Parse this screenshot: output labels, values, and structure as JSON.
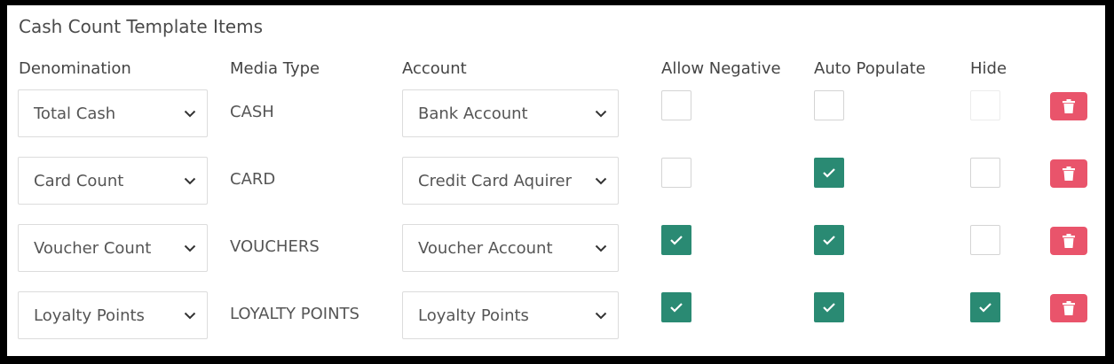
{
  "title": "Cash Count Template Items",
  "columns": {
    "denomination": "Denomination",
    "media_type": "Media Type",
    "account": "Account",
    "allow_negative": "Allow Negative",
    "auto_populate": "Auto Populate",
    "hide": "Hide"
  },
  "rows": [
    {
      "denomination": "Total Cash",
      "media_type": "CASH",
      "account": "Bank Account",
      "allow_negative": false,
      "auto_populate": false,
      "hide": false
    },
    {
      "denomination": "Card Count",
      "media_type": "CARD",
      "account": "Credit Card Aquirer",
      "allow_negative": false,
      "auto_populate": true,
      "hide": false
    },
    {
      "denomination": "Voucher Count",
      "media_type": "VOUCHERS",
      "account": "Voucher Account",
      "allow_negative": true,
      "auto_populate": true,
      "hide": false
    },
    {
      "denomination": "Loyalty Points",
      "media_type": "LOYALTY POINTS",
      "account": "Loyalty Points",
      "allow_negative": true,
      "auto_populate": true,
      "hide": true
    }
  ],
  "icons": {
    "dropdown": "chevron-down-icon",
    "checked": "checkmark-icon",
    "delete": "trash-icon"
  },
  "colors": {
    "checkbox_checked": "#2a8a73",
    "delete_button": "#e9546b"
  }
}
